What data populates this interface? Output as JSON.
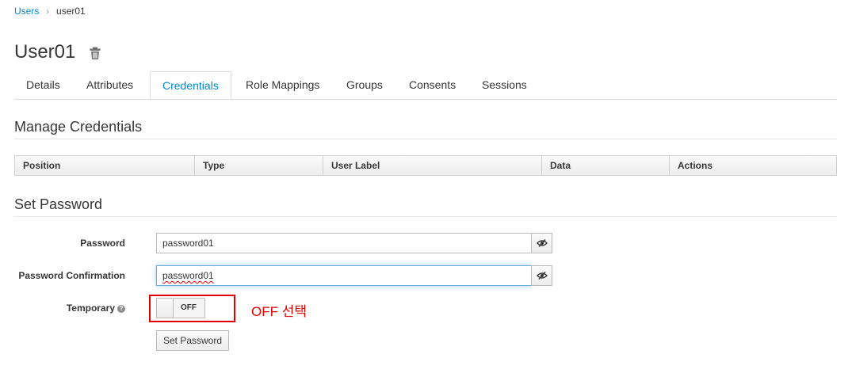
{
  "breadcrumb": {
    "parent": "Users",
    "separator": "›",
    "current": "user01"
  },
  "page": {
    "title": "User01",
    "delete_icon": "trash-icon"
  },
  "tabs": [
    {
      "label": "Details"
    },
    {
      "label": "Attributes"
    },
    {
      "label": "Credentials",
      "active": true
    },
    {
      "label": "Role Mappings"
    },
    {
      "label": "Groups"
    },
    {
      "label": "Consents"
    },
    {
      "label": "Sessions"
    }
  ],
  "manage_credentials": {
    "title": "Manage Credentials",
    "columns": [
      "Position",
      "Type",
      "User Label",
      "Data",
      "Actions"
    ]
  },
  "set_password": {
    "title": "Set Password",
    "password_label": "Password",
    "password_value": "password01",
    "confirm_label": "Password Confirmation",
    "confirm_value": "password01",
    "temporary_label": "Temporary",
    "temporary_state": "OFF",
    "submit_label": "Set Password"
  },
  "annotation": {
    "text": "OFF 선택",
    "color": "#e00000"
  },
  "colors": {
    "link": "#0088ce",
    "text": "#363636"
  }
}
